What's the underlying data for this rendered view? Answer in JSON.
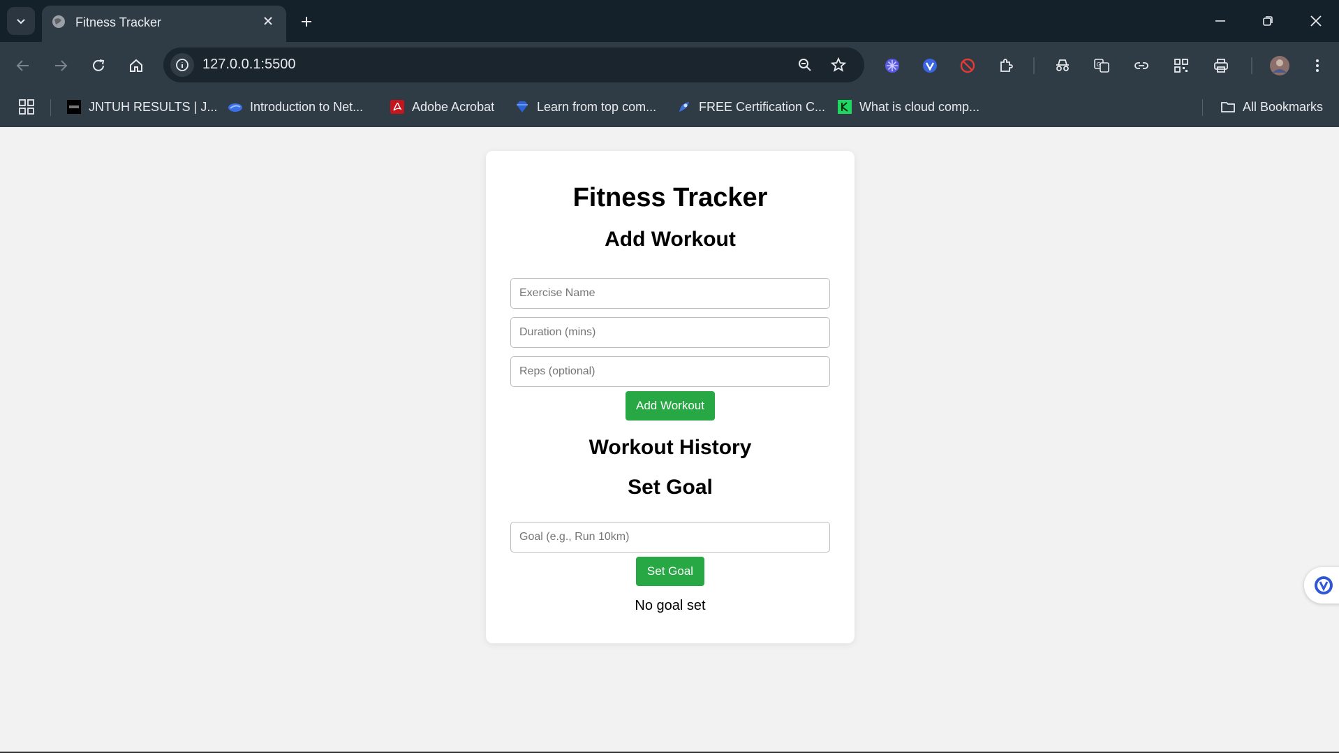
{
  "browser": {
    "tab_title": "Fitness Tracker",
    "url": "127.0.0.1:5500",
    "bookmarks": [
      {
        "label": "JNTUH RESULTS | J...",
        "icon": "jntuh-icon"
      },
      {
        "label": "Introduction to Net...",
        "icon": "cloud-icon"
      },
      {
        "label": "Adobe Acrobat",
        "icon": "acrobat-icon"
      },
      {
        "label": "Learn from top com...",
        "icon": "diamond-icon"
      },
      {
        "label": "FREE Certification C...",
        "icon": "cert-icon"
      },
      {
        "label": "What is cloud comp...",
        "icon": "green-logo-icon"
      }
    ],
    "all_bookmarks": "All Bookmarks"
  },
  "page": {
    "title": "Fitness Tracker",
    "add_workout_heading": "Add Workout",
    "exercise_placeholder": "Exercise Name",
    "duration_placeholder": "Duration (mins)",
    "reps_placeholder": "Reps (optional)",
    "add_workout_button": "Add Workout",
    "history_heading": "Workout History",
    "goal_heading": "Set Goal",
    "goal_placeholder": "Goal (e.g., Run 10km)",
    "set_goal_button": "Set Goal",
    "goal_status": "No goal set"
  },
  "colors": {
    "accent_green": "#28a745",
    "chrome_dark": "#14202a",
    "chrome_toolbar": "#2f3b45",
    "page_bg": "#f2f2f2"
  }
}
